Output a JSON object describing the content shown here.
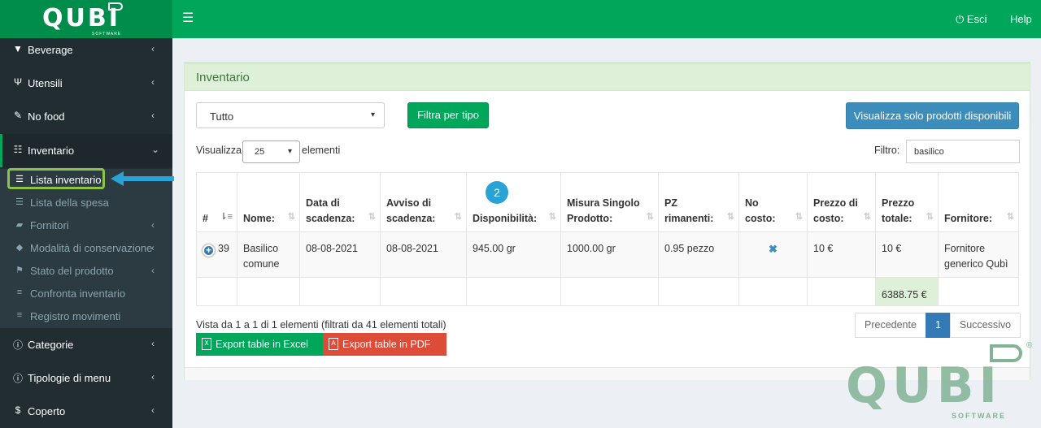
{
  "brand": {
    "name": "QUBI",
    "sub": "SOFTWARE"
  },
  "topbar": {
    "menu_icon": "hamburger-icon",
    "logout": "Esci",
    "help": "Help"
  },
  "sidebar": {
    "items": [
      {
        "label": "Beverage",
        "icon": "glass-icon"
      },
      {
        "label": "Utensili",
        "icon": "utensils-icon"
      },
      {
        "label": "No food",
        "icon": "wrench-icon"
      },
      {
        "label": "Inventario",
        "icon": "table-icon"
      },
      {
        "label": "Categorie",
        "icon": "info-icon"
      },
      {
        "label": "Tipologie di menu",
        "icon": "info-icon"
      },
      {
        "label": "Coperto",
        "icon": "dollar-icon"
      }
    ],
    "subitems": [
      {
        "label": "Lista inventario",
        "icon": "list-icon"
      },
      {
        "label": "Lista della spesa",
        "icon": "list-ol-icon"
      },
      {
        "label": "Fornitori",
        "icon": "truck-icon"
      },
      {
        "label": "Modalità di conservazione",
        "icon": "cube-icon"
      },
      {
        "label": "Stato del prodotto",
        "icon": "flag-icon"
      },
      {
        "label": "Confronta inventario",
        "icon": "bars-icon"
      },
      {
        "label": "Registro movimenti",
        "icon": "bars-icon"
      }
    ]
  },
  "main": {
    "title": "Inventario",
    "type_select": "Tutto",
    "filter_button": "Filtra per tipo",
    "available_button": "Visualizza solo prodotti disponibili",
    "show_prefix": "Visualizza",
    "show_value": "25",
    "show_suffix": "elementi",
    "filter_label": "Filtro:",
    "filter_value": "basilico",
    "callout": "2"
  },
  "table": {
    "headers": [
      "#",
      "Nome:",
      "Data di scadenza:",
      "Avviso di scadenza:",
      "Disponibilità:",
      "Misura Singolo Prodotto:",
      "PZ rimanenti:",
      "No costo:",
      "Prezzo di costo:",
      "Prezzo totale:",
      "Fornitore:"
    ],
    "row": {
      "id": "39",
      "name": "Basilico comune",
      "expiry": "08-08-2021",
      "warning": "08-08-2021",
      "availability": "945.00 gr",
      "unit_size": "1000.00 gr",
      "pieces": "0.95 pezzo",
      "no_cost": "✖",
      "cost": "10 €",
      "total": "10 €",
      "supplier": "Fornitore generico Qubì"
    },
    "grand_total": "6388.75 €"
  },
  "footer": {
    "info": "Vista da 1 a 1 di 1 elementi (filtrati da 41 elementi totali)",
    "excel": "Export table in Excel",
    "pdf": "Export table in PDF",
    "prev": "Precedente",
    "page": "1",
    "next": "Successivo"
  },
  "colors": {
    "primary_green": "#00a65a",
    "blue": "#3c8dbc",
    "red": "#dd4b39",
    "sidebar": "#222d32"
  }
}
